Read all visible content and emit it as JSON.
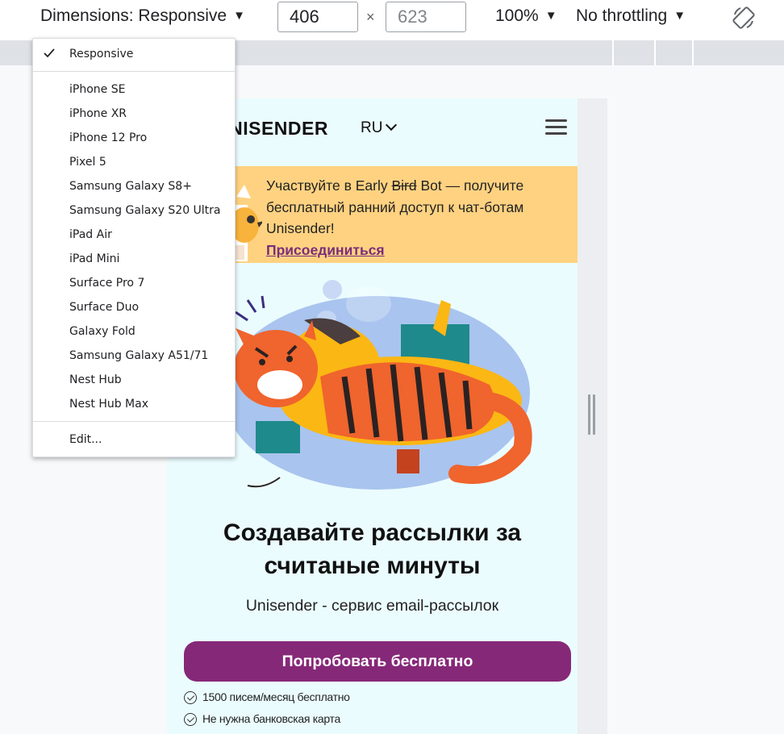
{
  "toolbar": {
    "dimensions_label": "Dimensions: Responsive",
    "width_value": "406",
    "height_placeholder": "623",
    "times_sign": "×",
    "zoom": "100%",
    "throttling": "No throttling",
    "caret": "▼"
  },
  "dropdown": {
    "selected": "Responsive",
    "devices": [
      "iPhone SE",
      "iPhone XR",
      "iPhone 12 Pro",
      "Pixel 5",
      "Samsung Galaxy S8+",
      "Samsung Galaxy S20 Ultra",
      "iPad Air",
      "iPad Mini",
      "Surface Pro 7",
      "Surface Duo",
      "Galaxy Fold",
      "Samsung Galaxy A51/71",
      "Nest Hub",
      "Nest Hub Max"
    ],
    "edit": "Edit..."
  },
  "site": {
    "logo": "UNISENDER",
    "lang": "RU",
    "banner": {
      "text_before": "Участвуйте в Early ",
      "text_strike": "Bird",
      "text_after": " Bot — получите бесплатный ранний доступ к чат-ботам Unisender!",
      "link": "Присоединиться"
    },
    "hero_title": "Создавайте рассылки за считаные минуты",
    "hero_subtitle": "Unisender - сервис email-рассылок",
    "cta": "Попробовать бесплатно",
    "features": [
      "1500 писем/месяц бесплатно",
      "Не нужна банковская карта"
    ]
  },
  "colors": {
    "cta": "#862878",
    "banner": "#ffd281",
    "page_bg": "#ebfcff",
    "tiger_orange": "#f0642d",
    "dog_yellow": "#fbb713"
  }
}
